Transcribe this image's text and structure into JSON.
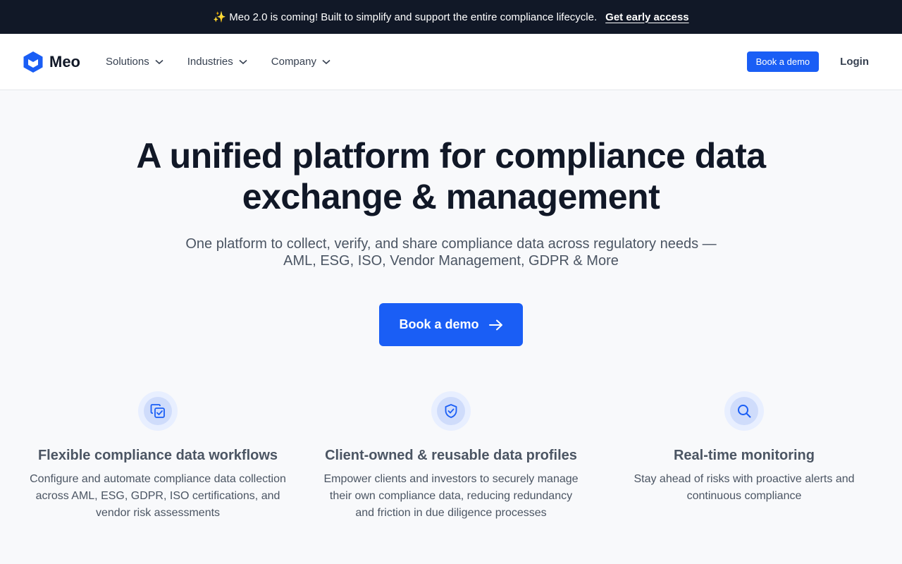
{
  "announcement": {
    "text": "✨ Meo 2.0 is coming! Built to simplify and support the entire compliance lifecycle.",
    "link": "Get early access"
  },
  "nav": {
    "logo": "Meo",
    "menu": [
      {
        "label": "Solutions"
      },
      {
        "label": "Industries"
      },
      {
        "label": "Company"
      }
    ],
    "demo_button": "Book a demo",
    "login": "Login"
  },
  "hero": {
    "title": "A unified platform for compliance data exchange & management",
    "subtitle": "One platform to collect, verify, and share compliance data across regulatory needs — AML, ESG, ISO, Vendor Management, GDPR & More",
    "cta": "Book a demo"
  },
  "features": [
    {
      "icon": "copy-check-icon",
      "title": "Flexible compliance data workflows",
      "text": "Configure and automate compliance data collection across AML, ESG, GDPR, ISO certifications, and vendor risk assessments"
    },
    {
      "icon": "shield-check-icon",
      "title": "Client-owned & reusable data profiles",
      "text": "Empower clients and investors to securely manage their own compliance data, reducing redundancy and friction in due diligence processes"
    },
    {
      "icon": "search-icon",
      "title": "Real-time monitoring",
      "text": "Stay ahead of risks with proactive alerts and continuous compliance"
    }
  ],
  "colors": {
    "accent": "#1a5ef5",
    "dark": "#111827"
  }
}
